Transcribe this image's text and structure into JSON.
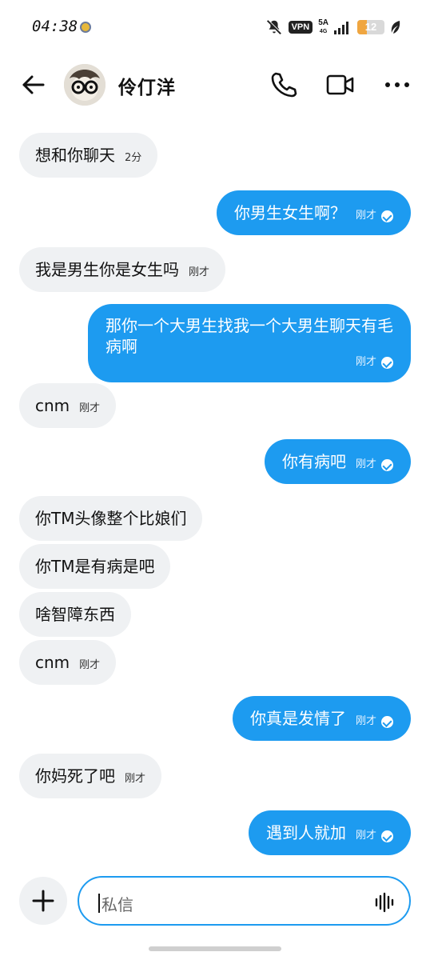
{
  "status_bar": {
    "time": "04:38",
    "vpn_label": "VPN",
    "network_label": "5A",
    "network_sub": "4G",
    "battery_level": "12",
    "battery_fraction": 0.12
  },
  "header": {
    "contact_name": "伶仃洋",
    "icons": [
      "back-arrow-icon",
      "phone-icon",
      "video-camera-icon",
      "more-icon"
    ]
  },
  "messages": [
    {
      "side": "in",
      "text": "想和你聊天",
      "time": "2分"
    },
    {
      "side": "out",
      "text": "你男生女生啊？",
      "time": "刚才"
    },
    {
      "side": "in",
      "text": "我是男生你是女生吗",
      "time": "刚才"
    },
    {
      "side": "out",
      "text": "那你一个大男生找我一个大男生聊天有毛病啊",
      "time": "刚才"
    },
    {
      "side": "in",
      "text": "cnm",
      "time": "刚才"
    },
    {
      "side": "out",
      "text": "你有病吧",
      "time": "刚才"
    },
    {
      "side": "in",
      "text": "你TM头像整个比娘们",
      "time": ""
    },
    {
      "side": "in",
      "text": "你TM是有病是吧",
      "time": ""
    },
    {
      "side": "in",
      "text": "啥智障东西",
      "time": ""
    },
    {
      "side": "in",
      "text": "cnm",
      "time": "刚才"
    },
    {
      "side": "out",
      "text": "你真是发情了",
      "time": "刚才"
    },
    {
      "side": "in",
      "text": "你妈死了吧",
      "time": "刚才"
    },
    {
      "side": "out",
      "text": "遇到人就加",
      "time": "刚才"
    }
  ],
  "composer": {
    "placeholder": "私信"
  },
  "colors": {
    "accent": "#1d9bf0",
    "incoming_bubble": "#eff1f3"
  }
}
